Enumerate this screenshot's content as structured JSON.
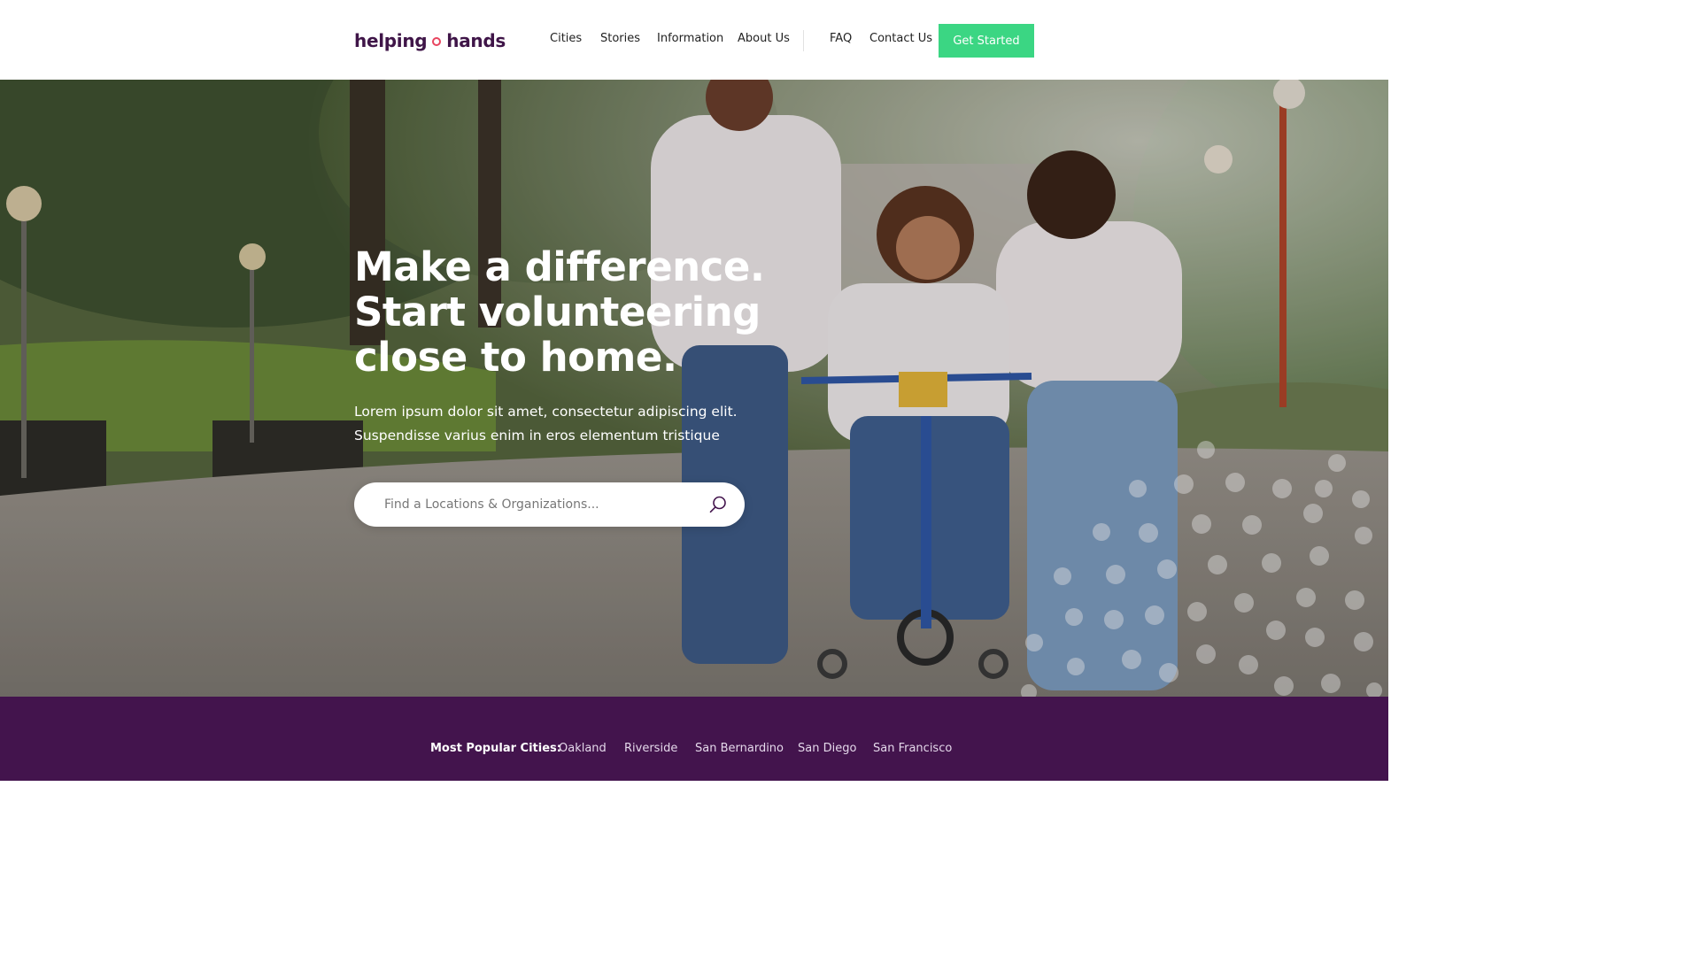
{
  "header": {
    "logo_left": "helping",
    "logo_right": "hands",
    "nav": [
      "Cities",
      "Stories",
      "Information",
      "About Us",
      "FAQ",
      "Contact Us"
    ],
    "cta_label": "Get Started"
  },
  "hero": {
    "title_lines": [
      "Make a difference.",
      "Start volunteering",
      "close to home."
    ],
    "subtitle_lines": [
      "Lorem ipsum dolor sit amet, consectetur adipiscing elit.",
      "Suspendisse varius enim in eros elementum tristique"
    ],
    "search_placeholder": "Find a Locations & Organizations..."
  },
  "popular": {
    "label": "Most Popular Cities:",
    "cities": [
      "Oakland",
      "Riverside",
      "San Bernardino",
      "San Diego",
      "San Francisco"
    ]
  },
  "colors": {
    "brand_purple": "#43144d",
    "logo_color": "#3f1548",
    "logo_dot": "#e8455f",
    "cta_green": "#3bd683"
  },
  "icons": {
    "search": "search-icon",
    "logo_mark": "circle-dot-icon"
  }
}
